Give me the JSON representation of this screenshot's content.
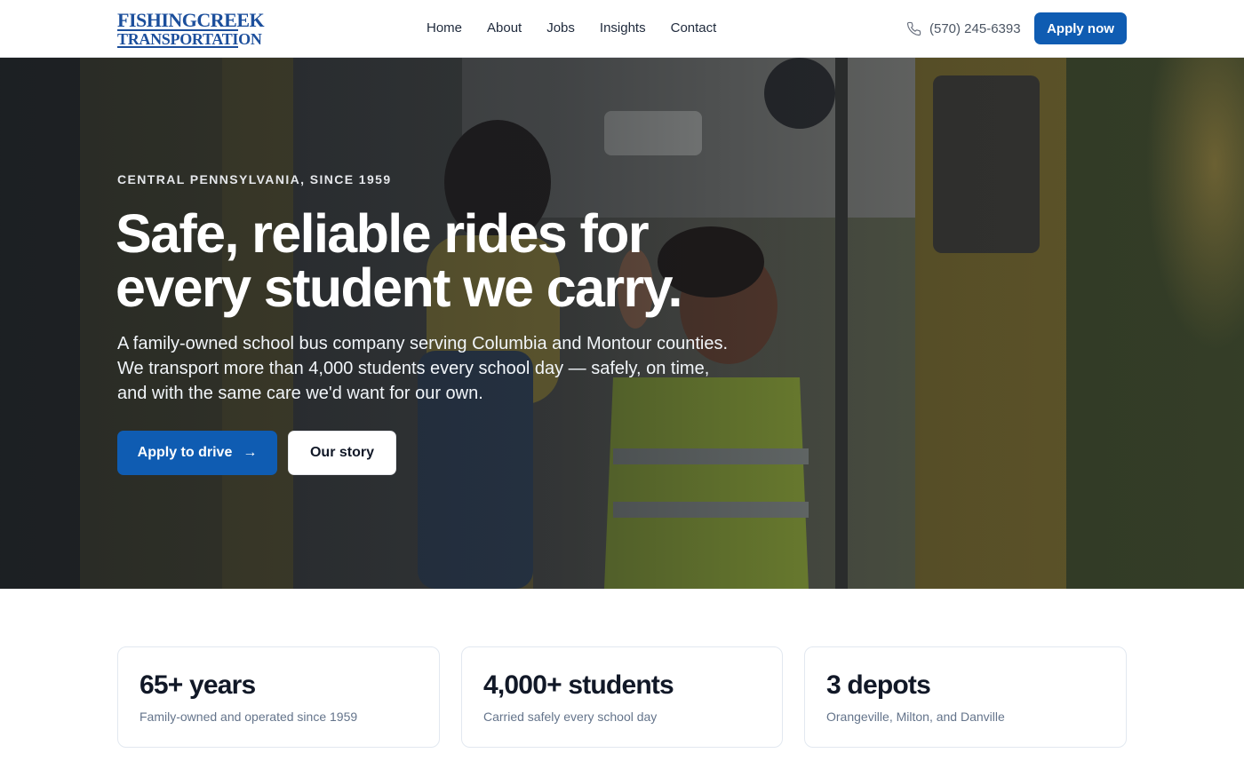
{
  "brand": {
    "logo_line1": "FISHINGCREEK",
    "logo_line2": "TRANSPORTATION",
    "color": "#1c4f9c"
  },
  "nav": {
    "items": [
      {
        "label": "Home"
      },
      {
        "label": "About"
      },
      {
        "label": "Jobs"
      },
      {
        "label": "Insights"
      },
      {
        "label": "Contact"
      }
    ]
  },
  "header": {
    "phone": "(570) 245-6393",
    "phone_icon": "phone-icon",
    "apply_label": "Apply now"
  },
  "hero": {
    "eyebrow": "CENTRAL PENNSYLVANIA, SINCE 1959",
    "headline": "Safe, reliable rides for every student we carry.",
    "subtext": "A family-owned school bus company serving Columbia and Montour counties. We transport more than 4,000 students every school day — safely, on time, and with the same care we'd want for our own.",
    "primary_cta": "Apply to drive",
    "primary_cta_icon": "arrow-right-icon",
    "secondary_cta": "Our story",
    "accent": "#0f5cb2"
  },
  "stats": [
    {
      "value": "65+ years",
      "label": "Family-owned and operated since 1959"
    },
    {
      "value": "4,000+ students",
      "label": "Carried safely every school day"
    },
    {
      "value": "3 depots",
      "label": "Orangeville, Milton, and Danville"
    }
  ]
}
